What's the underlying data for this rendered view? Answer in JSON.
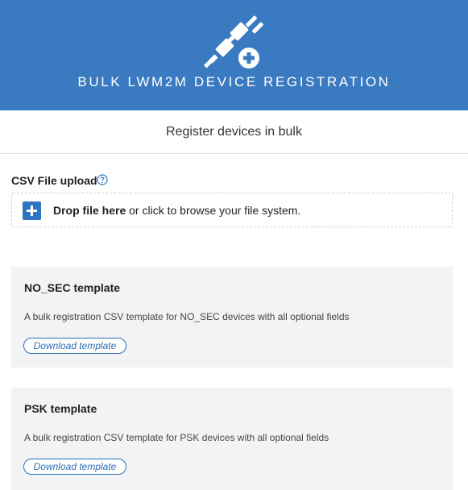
{
  "header": {
    "title": "BULK LWM2M DEVICE REGISTRATION",
    "icon": "plug-add-icon"
  },
  "subheader": {
    "title": "Register devices in bulk"
  },
  "upload": {
    "label": "CSV File upload",
    "help_icon": "help-circle-icon",
    "drop_strong": "Drop file here",
    "drop_rest": "or click to browse your file system."
  },
  "templates": [
    {
      "title": "NO_SEC template",
      "description": "A bulk registration CSV template for NO_SEC devices with all optional fields",
      "button": "Download template"
    },
    {
      "title": "PSK template",
      "description": "A bulk registration CSV template for PSK devices with all optional fields",
      "button": "Download template"
    }
  ],
  "colors": {
    "header_bg": "#3a7ac1",
    "accent": "#2f74c0",
    "card_bg": "#f2f3f5"
  }
}
